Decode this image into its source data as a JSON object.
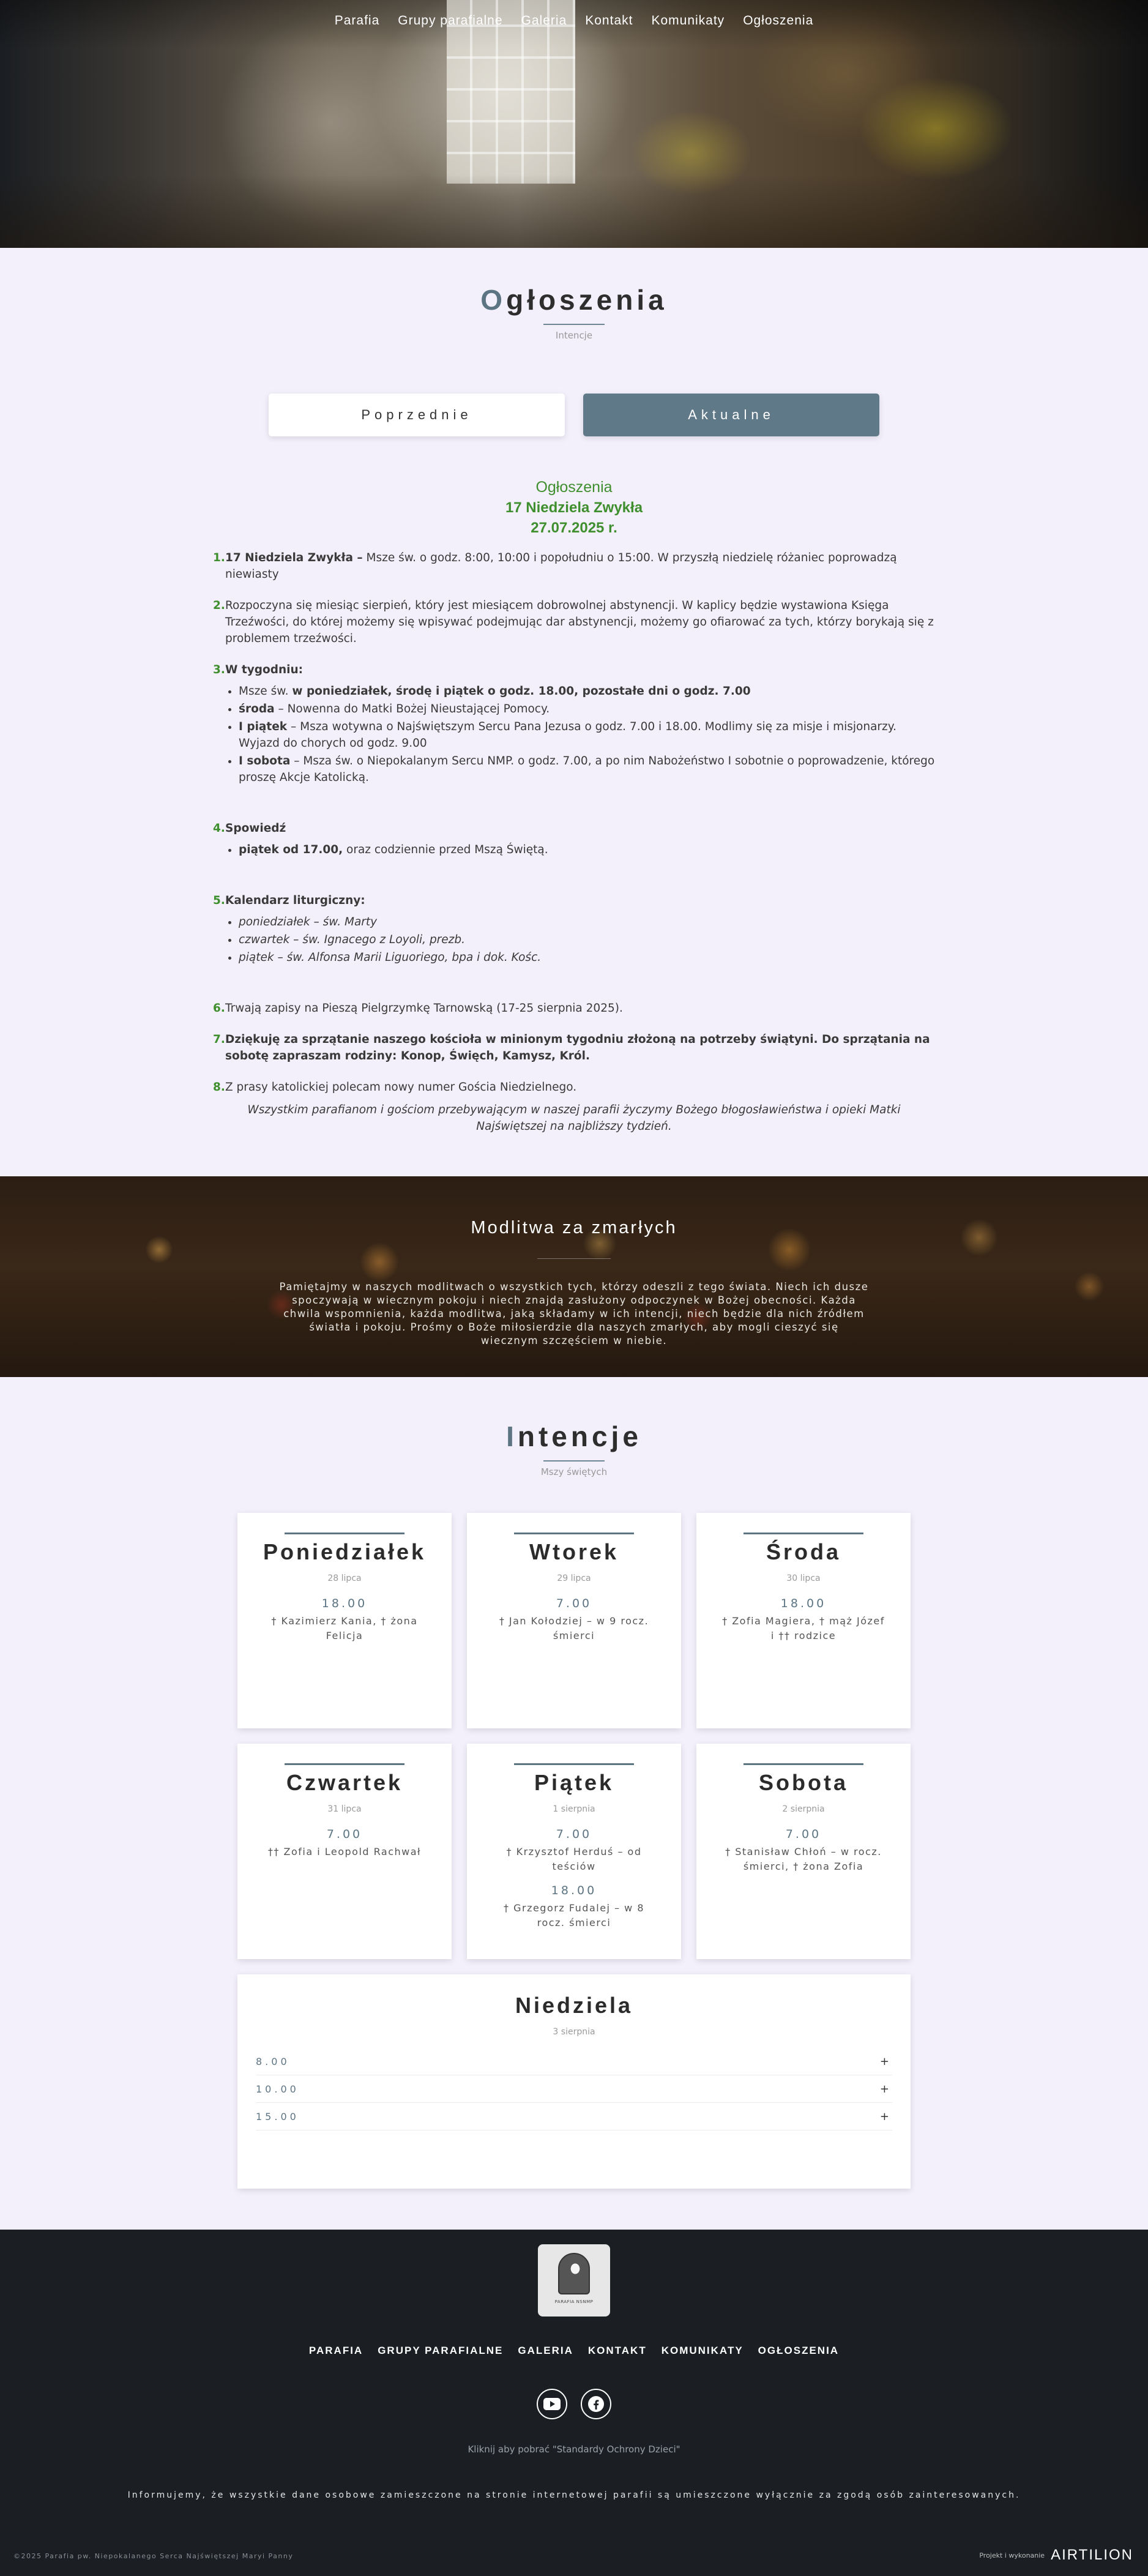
{
  "nav": [
    "Parafia",
    "Grupy parafialne",
    "Galeria",
    "Kontakt",
    "Komunikaty",
    "Ogłoszenia"
  ],
  "ogloszenia": {
    "title_first": "O",
    "title_rest": "głoszenia",
    "subtitle": "Intencje",
    "tab_prev": "Poprzednie",
    "tab_current": "Aktualne",
    "head1": "Ogłoszenia",
    "head2": "17 Niedziela Zwykła",
    "head3": "27.07.2025 r.",
    "items": {
      "i1_num": "1.",
      "i1_bold": "17 Niedziela Zwykła –",
      "i1_text": " Msze św. o godz. 8:00, 10:00 i popołudniu o 15:00. W przyszłą niedzielę różaniec poprowadzą niewiasty",
      "i2_num": "2.",
      "i2_text": "Rozpoczyna się miesiąc sierpień, który jest miesiącem dobrowolnej abstynencji. W kaplicy będzie wystawiona Księga Trzeźwości, do której możemy się wpisywać podejmując dar abstynencji, możemy go ofiarować za tych, którzy borykają się z problemem trzeźwości.",
      "i3_num": "3.",
      "i3_bold": "W tygodniu:",
      "i3_b1_pre": "Msze św. ",
      "i3_b1_bold": "w poniedziałek, środę i piątek o godz. 18.00, pozostałe dni o godz. 7.00",
      "i3_b2_bold": "środa",
      "i3_b2_text": " – Nowenna do Matki Bożej Nieustającej Pomocy.",
      "i3_b3_bold": "I piątek",
      "i3_b3_text": " – Msza wotywna o Najświętszym Sercu Pana Jezusa o godz. 7.00 i 18.00. Modlimy się za misje i misjonarzy. Wyjazd do chorych od godz. 9.00",
      "i3_b4_bold": "I sobota",
      "i3_b4_text": " –  Msza św. o Niepokalanym Sercu NMP. o godz. 7.00, a po nim Nabożeństwo I sobotnie o poprowadzenie, którego proszę Akcje Katolicką.",
      "i4_num": "4.",
      "i4_bold": "Spowiedź",
      "i4_b1_bold": "piątek od 17.00,",
      "i4_b1_text": " oraz codziennie przed Mszą Świętą.",
      "i5_num": "5.",
      "i5_bold": "Kalendarz liturgiczny:",
      "i5_b1": "poniedziałek –  św. Marty",
      "i5_b2": "czwartek  – św. Ignacego z Loyoli, prezb.",
      "i5_b3": "piątek – św. Alfonsa Marii Liguoriego, bpa i dok. Kośc.",
      "i6_num": "6.",
      "i6_text": "Trwają zapisy na Pieszą Pielgrzymkę Tarnowską (17-25 sierpnia 2025).",
      "i7_num": "7.",
      "i7_bold": "Dziękuję za sprzątanie naszego kościoła w  minionym tygodniu złożoną na potrzeby świątyni. Do sprzątania na sobotę zapraszam rodziny: Konop, Święch, Kamysz, Król.",
      "i8_num": "8.",
      "i8_text": " Z prasy katolickiej polecam nowy numer Gościa Niedzielnego."
    },
    "closing": "Wszystkim parafianom i gościom przebywającym w naszej parafii życzymy Bożego błogosławieństwa i opieki Matki Najświętszej na najbliższy tydzień."
  },
  "prayer": {
    "title": "Modlitwa za zmarłych",
    "text": "Pamiętajmy w naszych modlitwach o wszystkich tych, którzy odeszli z tego świata. Niech ich dusze spoczywają w wiecznym pokoju i niech znajdą zasłużony odpoczynek w Bożej obecności. Każda chwila wspomnienia, każda modlitwa, jaką składamy w ich intencji, niech będzie dla nich źródłem światła i pokoju. Prośmy o Boże miłosierdzie dla naszych zmarłych, aby mogli cieszyć się wiecznym szczęściem w niebie."
  },
  "intencje": {
    "title_first": "I",
    "title_rest": "ntencje",
    "subtitle": "Mszy świętych",
    "days": [
      {
        "day": "Poniedziałek",
        "date": "28 lipca",
        "masses": [
          {
            "time": "18.00",
            "intent": "† Kazimierz Kania, † żona Felicja"
          }
        ]
      },
      {
        "day": "Wtorek",
        "date": "29 lipca",
        "masses": [
          {
            "time": "7.00",
            "intent": "† Jan Kołodziej – w 9 rocz. śmierci"
          }
        ]
      },
      {
        "day": "Środa",
        "date": "30 lipca",
        "masses": [
          {
            "time": "18.00",
            "intent": "† Zofia Magiera, † mąż Józef i †† rodzice"
          }
        ]
      },
      {
        "day": "Czwartek",
        "date": "31 lipca",
        "masses": [
          {
            "time": "7.00",
            "intent": "†† Zofia i Leopold Rachwał"
          }
        ]
      },
      {
        "day": "Piątek",
        "date": "1 sierpnia",
        "masses": [
          {
            "time": "7.00",
            "intent": "† Krzysztof Herduś – od teściów"
          },
          {
            "time": "18.00",
            "intent": "† Grzegorz Fudalej – w 8 rocz. śmierci"
          }
        ]
      },
      {
        "day": "Sobota",
        "date": "2 sierpnia",
        "masses": [
          {
            "time": "7.00",
            "intent": "† Stanisław Chłoń – w rocz. śmierci, † żona Zofia"
          }
        ]
      }
    ],
    "sunday": {
      "day": "Niedziela",
      "date": "3 sierpnia",
      "times": [
        "8.00",
        "10.00",
        "15.00"
      ],
      "toggle": "+"
    }
  },
  "footer": {
    "logo_text": "PARAFIA NSNMP",
    "nav": [
      "PARAFIA",
      "GRUPY PARAFIALNE",
      "GALERIA",
      "KONTAKT",
      "KOMUNIKATY",
      "OGŁOSZENIA"
    ],
    "social_icons": [
      "youtube-icon",
      "facebook-icon"
    ],
    "standards_link": "Kliknij aby pobrać \"Standardy Ochrony Dzieci\"",
    "info": "Informujemy, że wszystkie dane osobowe zamieszczone na stronie internetowej parafii są umieszczone wyłącznie za zgodą osób zainteresowanych.",
    "copyright": "©2025 Parafia pw. Niepokalanego Serca Najświętszej Maryi Panny",
    "made_by_label": "Projekt i wykonanie",
    "made_by_brand": "AIRTILION"
  },
  "colors": {
    "accent": "#5f7989",
    "green": "#3f8f2f",
    "page_bg": "#f3f0fb",
    "footer_bg": "#1b1f24"
  }
}
